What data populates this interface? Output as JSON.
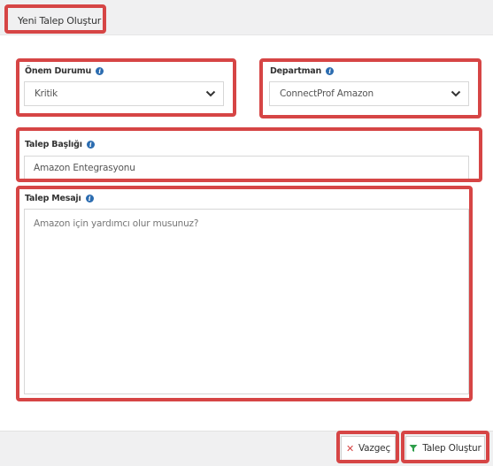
{
  "header": {
    "title": "Yeni Talep Oluştur"
  },
  "form": {
    "priority": {
      "label": "Önem Durumu",
      "value": "Kritik"
    },
    "department": {
      "label": "Departman",
      "value": "ConnectProf Amazon"
    },
    "subject": {
      "label": "Talep Başlığı",
      "value": "Amazon Entegrasyonu"
    },
    "message": {
      "label": "Talep Mesajı",
      "value": "Amazon için yardımcı olur musunuz?"
    }
  },
  "footer": {
    "cancel_label": "Vazgeç",
    "submit_label": "Talep Oluştur"
  },
  "colors": {
    "highlight": "#d64545",
    "info_icon": "#2b6cb0",
    "submit_icon": "#2e9e4a"
  },
  "icons": {
    "info": "info-circle-icon",
    "dropdown": "chevron-down-icon",
    "cancel": "close-icon",
    "submit": "funnel-icon"
  }
}
